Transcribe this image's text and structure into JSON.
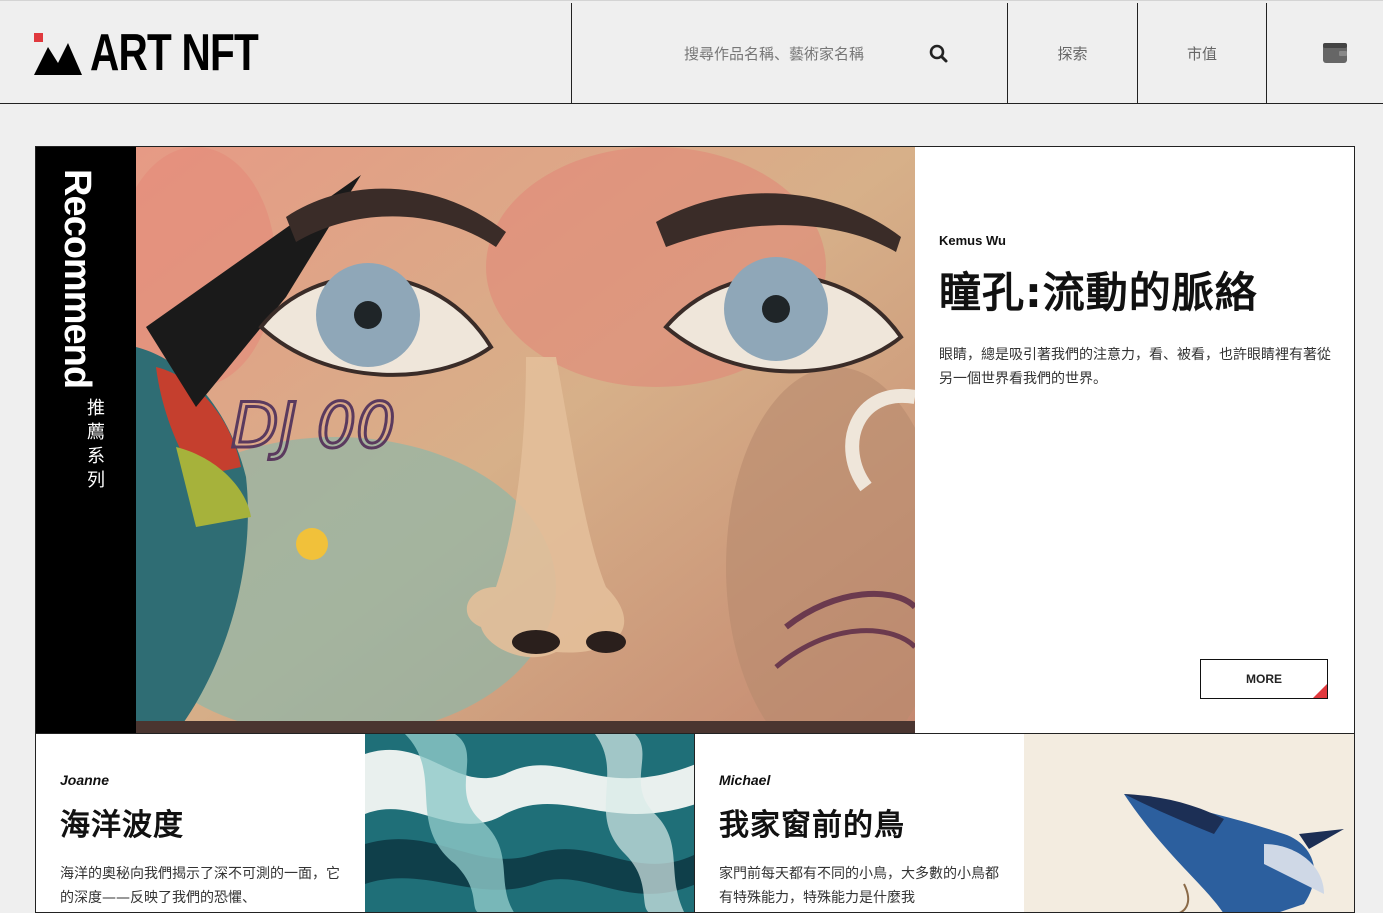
{
  "header": {
    "logo_text": "ART NFT",
    "search": {
      "placeholder": "搜尋作品名稱、藝術家名稱",
      "value": ""
    },
    "nav": [
      {
        "label": "探索"
      },
      {
        "label": "市值"
      }
    ]
  },
  "featured": {
    "section_label_en": "Recommend",
    "section_label_zh": "推薦系列",
    "artist": "Kemus Wu",
    "title": "瞳孔:流動的脈絡",
    "description": "眼睛，總是吸引著我們的注意力，看、被看，也許眼睛裡有著從另一個世界看我們的世界。",
    "more_label": "MORE"
  },
  "cards": [
    {
      "artist": "Joanne",
      "title": "海洋波度",
      "description": "海洋的奧秘向我們揭示了深不可測的一面，它的深度——反映了我們的恐懼、"
    },
    {
      "artist": "Michael",
      "title": "我家窗前的鳥",
      "description": "家門前每天都有不同的小鳥，大多數的小鳥都有特殊能力，特殊能力是什麼我"
    }
  ],
  "colors": {
    "accent": "#e0393e",
    "ink": "#000000",
    "background": "#efefef"
  },
  "icons": [
    "logo-mountain-icon",
    "search-icon",
    "wallet-icon"
  ]
}
